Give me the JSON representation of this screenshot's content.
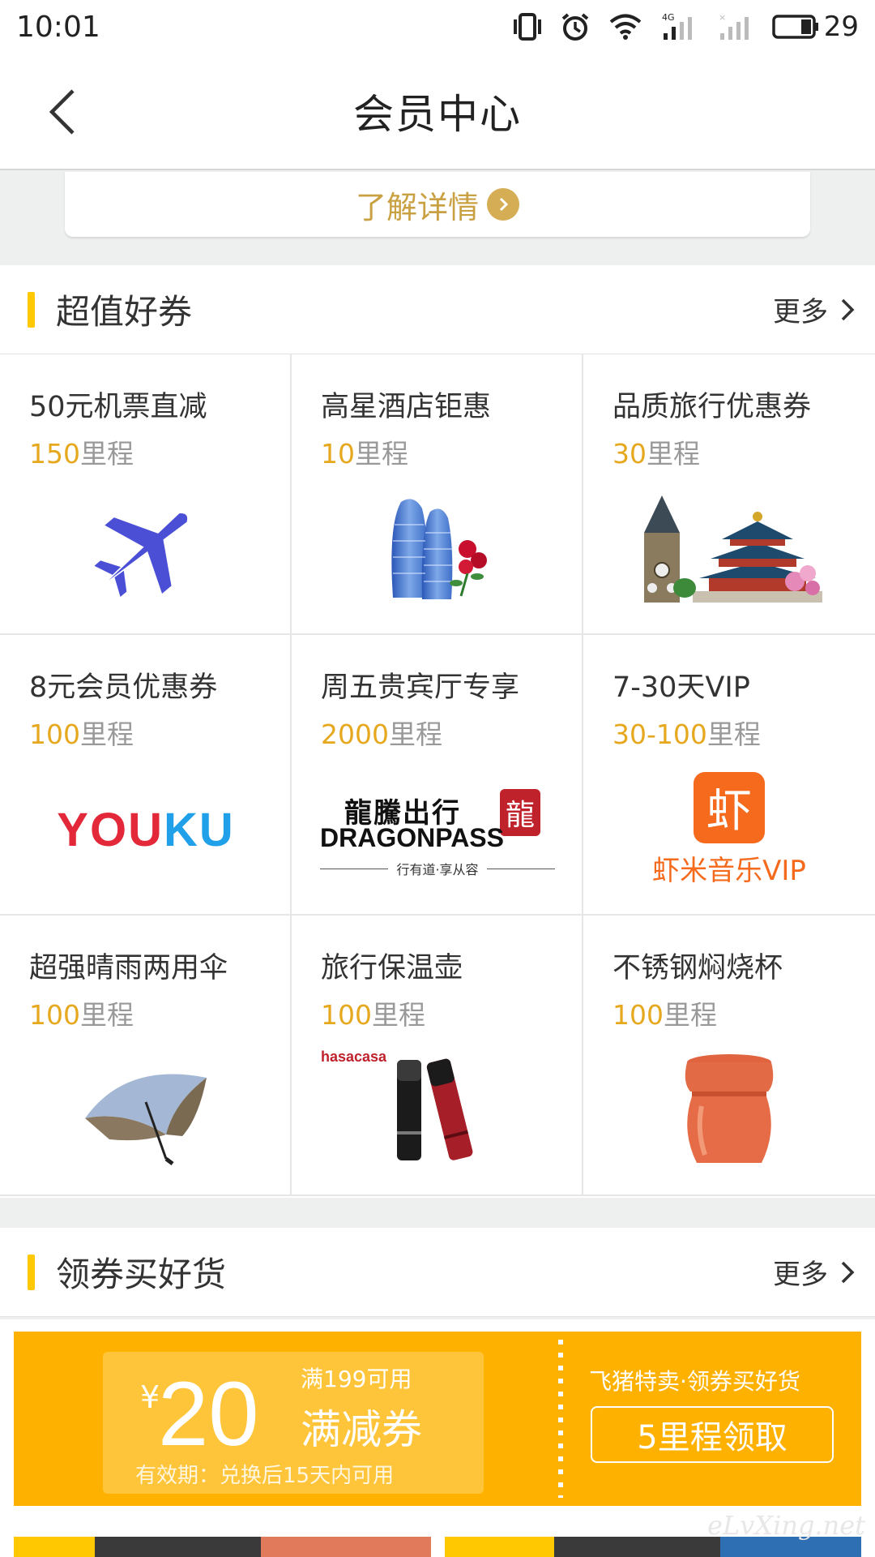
{
  "status_bar": {
    "time": "10:01",
    "network_label": "4G",
    "battery": "29"
  },
  "nav": {
    "title": "会员中心"
  },
  "detail_link": {
    "label": "了解详情"
  },
  "section_coupons": {
    "title": "超值好券",
    "more": "更多"
  },
  "coupon_grid": [
    {
      "name": "50元机票直减",
      "miles_num": "150",
      "miles_unit": "里程",
      "image": "airplane-icon"
    },
    {
      "name": "高星酒店钜惠",
      "miles_num": "10",
      "miles_unit": "里程",
      "image": "hotel-towers"
    },
    {
      "name": "品质旅行优惠券",
      "miles_num": "30",
      "miles_unit": "里程",
      "image": "landmarks"
    },
    {
      "name": "8元会员优惠券",
      "miles_num": "100",
      "miles_unit": "里程",
      "image": "youku-logo"
    },
    {
      "name": "周五贵宾厅专享",
      "miles_num": "2000",
      "miles_unit": "里程",
      "image": "dragonpass-logo"
    },
    {
      "name": "7-30天VIP",
      "miles_num": "30-100",
      "miles_unit": "里程",
      "image": "xiami-logo"
    },
    {
      "name": "超强晴雨两用伞",
      "miles_num": "100",
      "miles_unit": "里程",
      "image": "umbrella"
    },
    {
      "name": "旅行保温壶",
      "miles_num": "100",
      "miles_unit": "里程",
      "image": "thermos"
    },
    {
      "name": "不锈钢焖烧杯",
      "miles_num": "100",
      "miles_unit": "里程",
      "image": "cup"
    }
  ],
  "logos": {
    "youku": {
      "you": "YOU",
      "ku": "KU"
    },
    "dragonpass": {
      "cn": "龍騰出行",
      "en": "DRAGONPASS",
      "tagline": "行有道·享从容",
      "seal": "龍"
    },
    "xiami": {
      "icon_char": "虾",
      "text": "虾米音乐VIP"
    },
    "hasacasa": "hasacasa"
  },
  "section_goods": {
    "title": "领券买好货",
    "more": "更多"
  },
  "coupon_banner": {
    "yen": "¥",
    "amount": "20",
    "condition": "满199可用",
    "kind": "满减券",
    "validity": "有效期：兑换后15天内可用",
    "side_text": "飞猪特卖·领券买好货",
    "claim_label": "5里程领取"
  },
  "watermark": "eLvXing.net",
  "colors": {
    "accent": "#ffc800",
    "miles": "#e5a81e",
    "coupon_bg": "#ffb100",
    "detail_gold": "#c9a042"
  }
}
